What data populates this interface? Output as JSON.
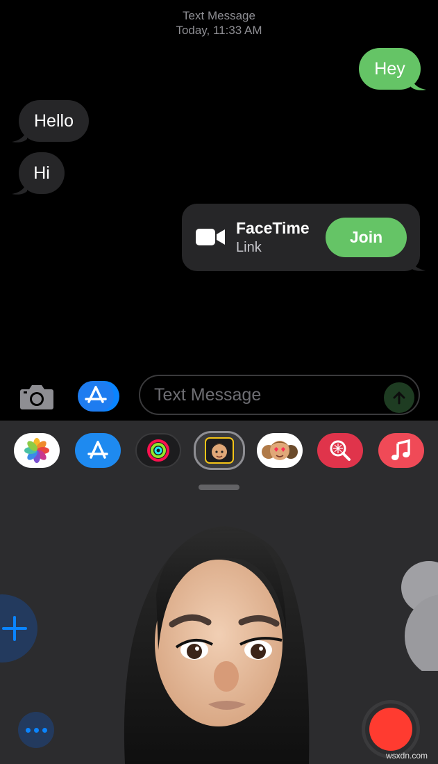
{
  "header": {
    "title": "Text Message",
    "time": "Today, 11:33 AM"
  },
  "messages": [
    {
      "text": "Hey",
      "direction": "outgoing"
    },
    {
      "text": "Hello",
      "direction": "incoming"
    },
    {
      "text": "Hi",
      "direction": "incoming"
    }
  ],
  "facetime": {
    "title": "FaceTime",
    "subtitle": "Link",
    "join_label": "Join",
    "icon": "video-camera-icon"
  },
  "composer": {
    "placeholder": "Text Message",
    "camera_icon": "camera-icon",
    "apps_icon": "app-store-icon",
    "send_icon": "arrow-up-icon"
  },
  "app_drawer": {
    "apps": [
      {
        "name": "photos-app-icon"
      },
      {
        "name": "app-store-app-icon"
      },
      {
        "name": "fitness-app-icon"
      },
      {
        "name": "memoji-app-icon",
        "selected": true
      },
      {
        "name": "memoji-stickers-app-icon"
      },
      {
        "name": "web-images-search-icon"
      },
      {
        "name": "music-app-icon"
      }
    ]
  },
  "memoji_panel": {
    "add_icon": "plus-icon",
    "more_icon": "ellipsis-icon",
    "record_icon": "record-icon"
  },
  "watermark": "wsxdn.com",
  "colors": {
    "outgoing_bubble": "#65c466",
    "incoming_bubble": "#262628",
    "record": "#ff3b30",
    "accent_blue": "#0a84ff"
  }
}
